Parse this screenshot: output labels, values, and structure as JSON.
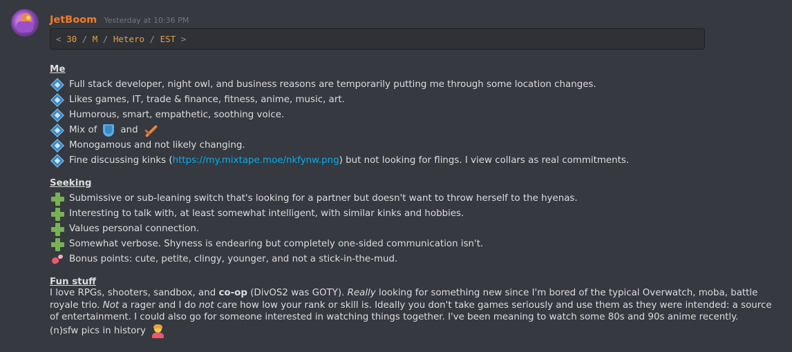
{
  "author": {
    "name": "JetBoom",
    "timestamp": "Yesterday at 10:36 PM",
    "name_color": "#f47b24"
  },
  "codebox": {
    "open": "<",
    "items": [
      "30",
      "M",
      "Hetero",
      "EST"
    ],
    "separator": "/",
    "close": ">"
  },
  "me": {
    "heading": "Me",
    "bullet_icon": "large-blue-diamond-icon",
    "lines": [
      "Full stack developer, night owl, and business reasons are temporarily putting me through some location changes.",
      "Likes games, IT, trade & finance, fitness, anime, music, art.",
      "Humorous, smart, empathetic, soothing voice.",
      "Monogamous and not likely changing."
    ],
    "mix_of": "Mix of",
    "mix_and": "and",
    "mix_icons": [
      "shield-icon",
      "dagger-icon"
    ],
    "kinks_prefix": "Fine discussing kinks (",
    "kinks_link": "https://my.mixtape.moe/nkfynw.png",
    "kinks_suffix": ") but not looking for flings. I view collars as real commitments."
  },
  "seeking": {
    "heading": "Seeking",
    "bullet_icon": "heavy-plus-icon",
    "lines": [
      "Submissive or sub-leaning switch that's looking for a partner but doesn't want to throw herself to the hyenas.",
      "Interesting to talk with, at least somewhat intelligent, with similar kinks and hobbies.",
      "Values personal connection.",
      "Somewhat verbose. Shyness is endearing but completely one-sided communication isn't."
    ],
    "bonus_icon": "two-hearts-icon",
    "bonus": "Bonus points: cute, petite, clingy, younger, and not a stick-in-the-mud."
  },
  "fun": {
    "heading": "Fun stuff",
    "p1": "I love RPGs, shooters, sandbox, and ",
    "p2": "co-op",
    "p3": " (DivOS2 was GOTY). ",
    "p4": "Really",
    "p5": " looking for something new since I'm bored of the typical Overwatch, moba, battle royale trio. ",
    "p6": "Not",
    "p7": " a rager and I do ",
    "p8": "not",
    "p9": " care how low your rank or skill is. Ideally you don't take games seriously and use them as they were intended: a source of entertainment. I could also go for someone interested in watching things together. I've been meaning to watch some 80s and 90s anime recently.",
    "pics": "(n)sfw pics in history",
    "pics_icon": "person-shrugging-icon"
  },
  "colors": {
    "background": "#36393f",
    "text": "#dcddde",
    "link": "#00aff4",
    "code_value": "#e0a23a"
  }
}
